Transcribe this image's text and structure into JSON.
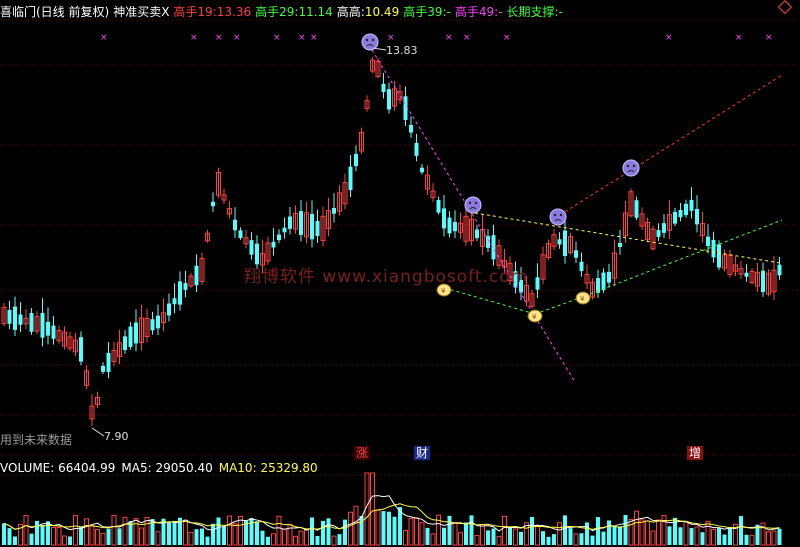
{
  "header": {
    "title": "喜临门(日线 前复权)",
    "indicator": "神准买卖X",
    "gs19_label": "高手19:",
    "gs19_value": "13.36",
    "gs29_label": "高手29:",
    "gs29_value": "11.14",
    "gg_label": "高高:",
    "gg_value": "10.49",
    "gs39_label": "高手39:",
    "gs39_value": "-",
    "gs49_label": "高手49:",
    "gs49_value": "-",
    "cq_label": "长期支撑:",
    "cq_value": "-"
  },
  "price_labels": {
    "high": "13.83",
    "low": "7.90"
  },
  "future_text": "用到未来数据",
  "watermark": "翔博软件 www.xiangbosoft.com",
  "events": {
    "e1": "涨",
    "e2": "财",
    "e3": "增"
  },
  "volume": {
    "vol_label": "VOLUME:",
    "vol_value": "66404.99",
    "ma5_label": "MA5:",
    "ma5_value": "29050.40",
    "ma10_label": "MA10:",
    "ma10_value": "25329.80"
  },
  "colors": {
    "up": "#ff4040",
    "down": "#54ffff",
    "magenta": "#ff40ff",
    "yellow": "#ffff40",
    "green": "#40ff40",
    "grid": "#7a0000"
  },
  "icons": {
    "top_marker": "sad-face-icon",
    "bottom_marker": "coin-bag-icon"
  }
}
